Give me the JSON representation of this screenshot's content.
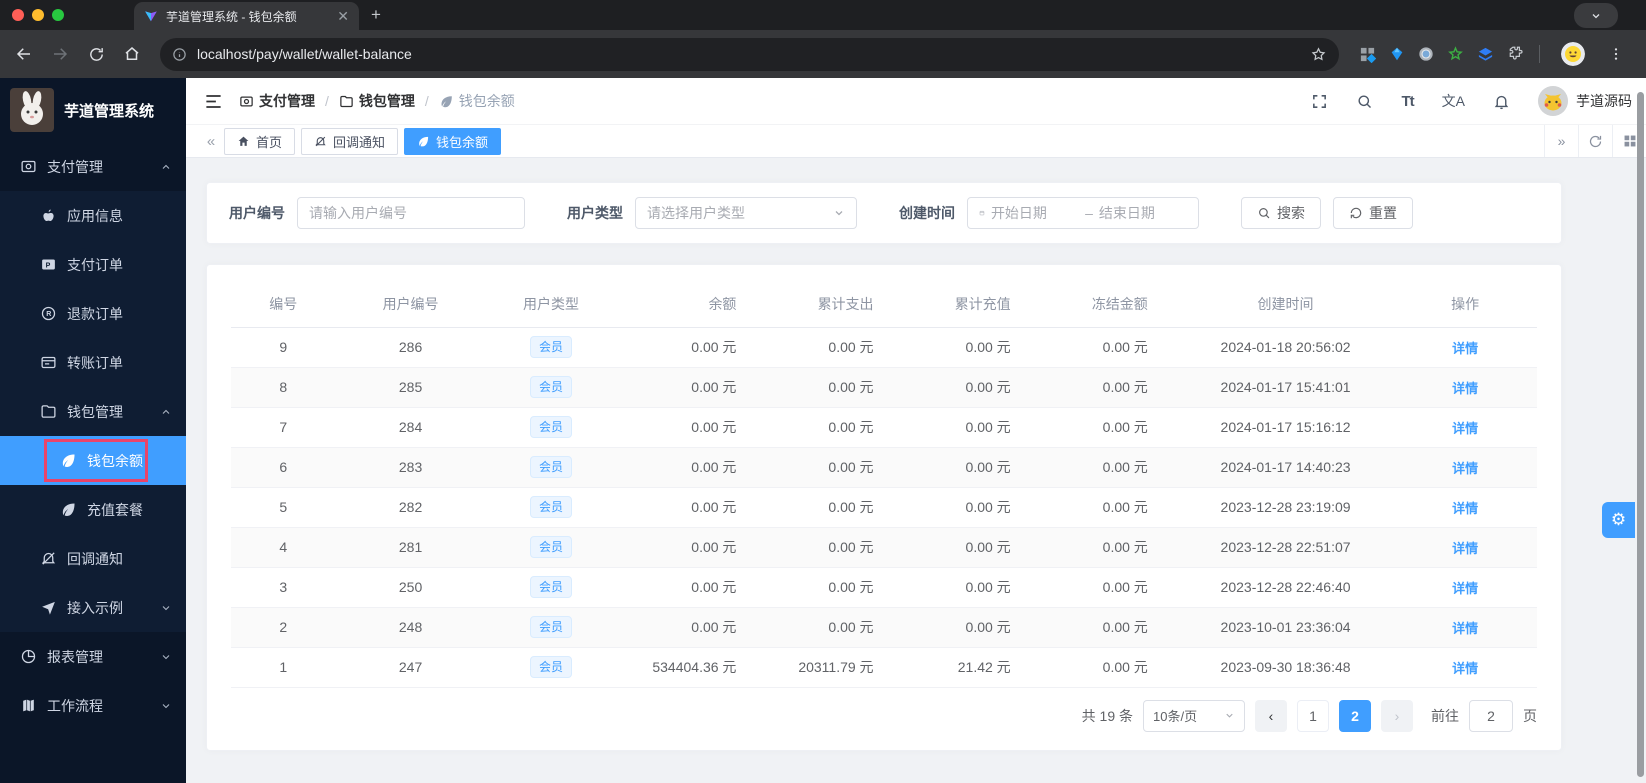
{
  "browser": {
    "tab_title": "芋道管理系统 - 钱包余额",
    "url": "localhost/pay/wallet/wallet-balance"
  },
  "sidebar": {
    "app_title": "芋道管理系统",
    "items": [
      {
        "label": "支付管理"
      },
      {
        "label": "应用信息"
      },
      {
        "label": "支付订单"
      },
      {
        "label": "退款订单"
      },
      {
        "label": "转账订单"
      },
      {
        "label": "钱包管理"
      },
      {
        "label": "钱包余额"
      },
      {
        "label": "充值套餐"
      },
      {
        "label": "回调通知"
      },
      {
        "label": "接入示例"
      },
      {
        "label": "报表管理"
      },
      {
        "label": "工作流程"
      }
    ]
  },
  "header": {
    "breadcrumb": [
      {
        "label": "支付管理"
      },
      {
        "label": "钱包管理"
      },
      {
        "label": "钱包余额"
      }
    ],
    "separator": "/",
    "font_icon_text": "Tt",
    "locale_icon_text": "文A",
    "user_name": "芋道源码"
  },
  "tabs": {
    "items": [
      {
        "label": "首页"
      },
      {
        "label": "回调通知"
      },
      {
        "label": "钱包余额"
      }
    ]
  },
  "filter": {
    "user_no_label": "用户编号",
    "user_no_placeholder": "请输入用户编号",
    "user_type_label": "用户类型",
    "user_type_placeholder": "请选择用户类型",
    "create_time_label": "创建时间",
    "date_start_placeholder": "开始日期",
    "date_separator": "–",
    "date_end_placeholder": "结束日期",
    "search_label": "搜索",
    "reset_label": "重置"
  },
  "table": {
    "columns": [
      "编号",
      "用户编号",
      "用户类型",
      "余额",
      "累计支出",
      "累计充值",
      "冻结金额",
      "创建时间",
      "操作"
    ],
    "action_label": "详情",
    "rows": [
      {
        "id": "9",
        "user_no": "286",
        "user_type": "会员",
        "balance": "0.00 元",
        "expense": "0.00 元",
        "recharge": "0.00 元",
        "frozen": "0.00 元",
        "created": "2024-01-18 20:56:02"
      },
      {
        "id": "8",
        "user_no": "285",
        "user_type": "会员",
        "balance": "0.00 元",
        "expense": "0.00 元",
        "recharge": "0.00 元",
        "frozen": "0.00 元",
        "created": "2024-01-17 15:41:01"
      },
      {
        "id": "7",
        "user_no": "284",
        "user_type": "会员",
        "balance": "0.00 元",
        "expense": "0.00 元",
        "recharge": "0.00 元",
        "frozen": "0.00 元",
        "created": "2024-01-17 15:16:12"
      },
      {
        "id": "6",
        "user_no": "283",
        "user_type": "会员",
        "balance": "0.00 元",
        "expense": "0.00 元",
        "recharge": "0.00 元",
        "frozen": "0.00 元",
        "created": "2024-01-17 14:40:23"
      },
      {
        "id": "5",
        "user_no": "282",
        "user_type": "会员",
        "balance": "0.00 元",
        "expense": "0.00 元",
        "recharge": "0.00 元",
        "frozen": "0.00 元",
        "created": "2023-12-28 23:19:09"
      },
      {
        "id": "4",
        "user_no": "281",
        "user_type": "会员",
        "balance": "0.00 元",
        "expense": "0.00 元",
        "recharge": "0.00 元",
        "frozen": "0.00 元",
        "created": "2023-12-28 22:51:07"
      },
      {
        "id": "3",
        "user_no": "250",
        "user_type": "会员",
        "balance": "0.00 元",
        "expense": "0.00 元",
        "recharge": "0.00 元",
        "frozen": "0.00 元",
        "created": "2023-12-28 22:46:40"
      },
      {
        "id": "2",
        "user_no": "248",
        "user_type": "会员",
        "balance": "0.00 元",
        "expense": "0.00 元",
        "recharge": "0.00 元",
        "frozen": "0.00 元",
        "created": "2023-10-01 23:36:04"
      },
      {
        "id": "1",
        "user_no": "247",
        "user_type": "会员",
        "balance": "534404.36 元",
        "expense": "20311.79 元",
        "recharge": "21.42 元",
        "frozen": "0.00 元",
        "created": "2023-09-30 18:36:48"
      }
    ]
  },
  "pagination": {
    "total_label": "共 19 条",
    "page_size_label": "10条/页",
    "pages": [
      "1",
      "2"
    ],
    "current_page": "2",
    "goto_label": "前往",
    "goto_value": "2",
    "page_unit_label": "页"
  },
  "colors": {
    "accent": "#409eff",
    "annotation_box": "#e9446a",
    "sidebar_bg": "#0b1628",
    "submenu_bg": "#0f1d33",
    "tag_bg": "#ecf5ff",
    "tag_text": "#409eff",
    "content_bg": "#f0f2f5"
  }
}
